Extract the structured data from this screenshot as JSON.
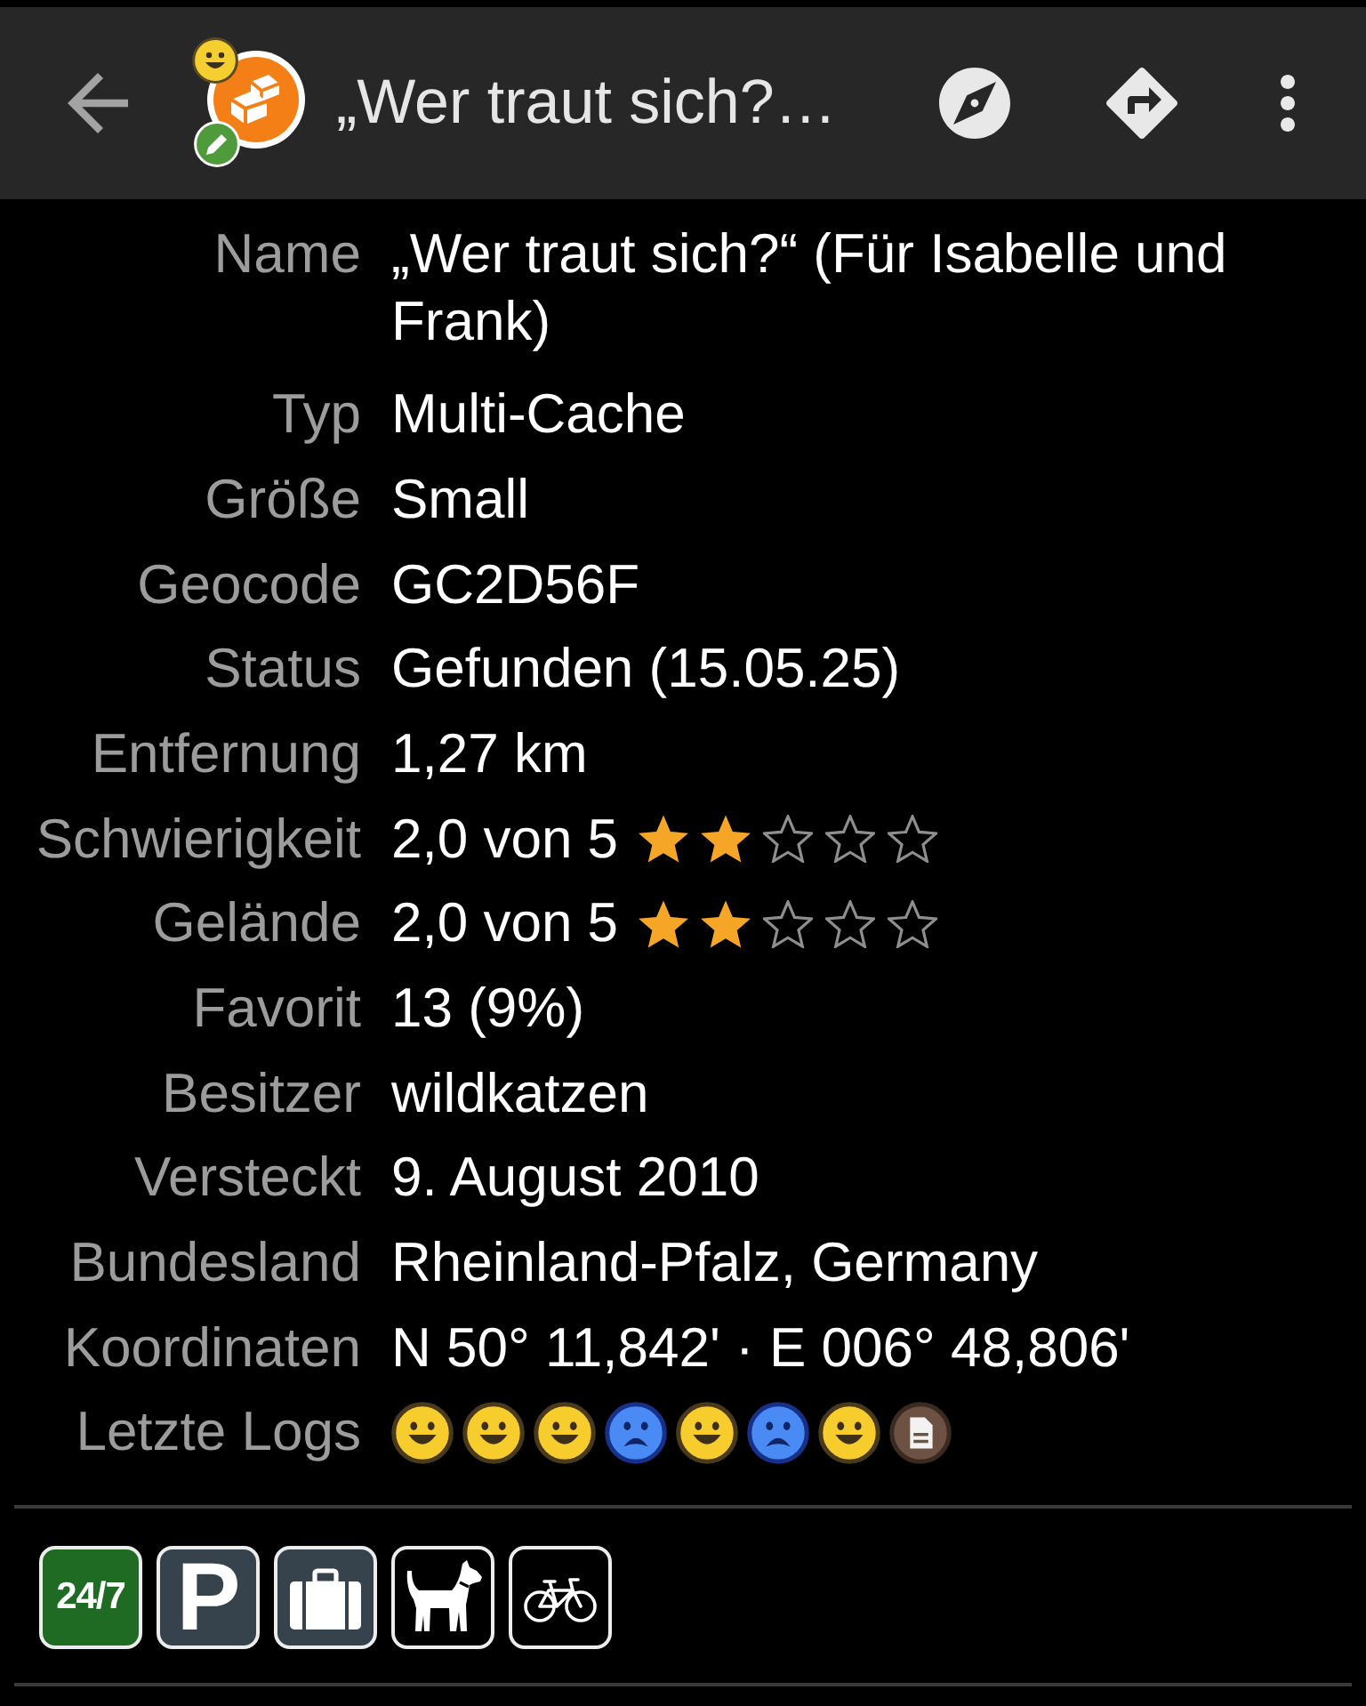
{
  "app_bar": {
    "title": "„Wer traut sich?…",
    "cache_icon": {
      "found": true,
      "has_note": true
    }
  },
  "details": [
    {
      "kind": "text",
      "label": "Name",
      "value": "„Wer traut sich?“ (Für Isabelle und Frank)"
    },
    {
      "kind": "text",
      "label": "Typ",
      "value": "Multi-Cache"
    },
    {
      "kind": "text",
      "label": "Größe",
      "value": "Small"
    },
    {
      "kind": "text",
      "label": "Geocode",
      "value": "GC2D56F"
    },
    {
      "kind": "text",
      "label": "Status",
      "value": "Gefunden (15.05.25)"
    },
    {
      "kind": "text",
      "label": "Entfernung",
      "value": "1,27 km"
    },
    {
      "kind": "rating",
      "label": "Schwierigkeit",
      "value": "2,0 von 5",
      "stars": 2
    },
    {
      "kind": "rating",
      "label": "Gelände",
      "value": "2,0 von 5",
      "stars": 2
    },
    {
      "kind": "text",
      "label": "Favorit",
      "value": "13 (9%)"
    },
    {
      "kind": "text",
      "label": "Besitzer",
      "value": "wildkatzen"
    },
    {
      "kind": "text",
      "label": "Versteckt",
      "value": "9. August 2010"
    },
    {
      "kind": "text",
      "label": "Bundesland",
      "value": "Rheinland-Pfalz, Germany"
    },
    {
      "kind": "text",
      "label": "Koordinaten",
      "value": "N 50° 11,842' · E 006° 48,806'"
    },
    {
      "kind": "logs",
      "label": "Letzte Logs",
      "logs": [
        {
          "kind": "found"
        },
        {
          "kind": "found"
        },
        {
          "kind": "found"
        },
        {
          "kind": "dnf"
        },
        {
          "kind": "found"
        },
        {
          "kind": "dnf"
        },
        {
          "kind": "found"
        },
        {
          "kind": "note"
        }
      ]
    }
  ],
  "attributes": [
    {
      "kind": "text",
      "text": "24/7",
      "color": "#1f6b24"
    },
    {
      "kind": "text",
      "text": "P",
      "color": "#37434c"
    },
    {
      "kind": "briefcase",
      "color": "#37434c"
    },
    {
      "kind": "dog",
      "color": "#000000"
    },
    {
      "kind": "bicycle",
      "color": "#000000"
    }
  ]
}
